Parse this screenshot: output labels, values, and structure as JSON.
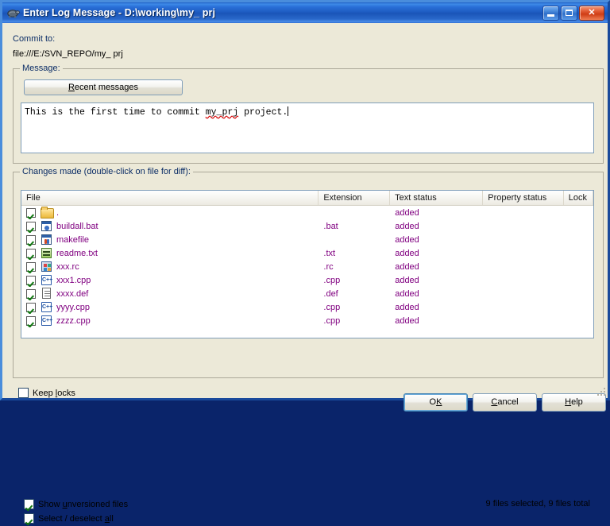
{
  "window": {
    "title": "Enter Log Message - D:\\working\\my_ prj",
    "icon": "tortoise-icon",
    "minimize_label": "",
    "maximize_label": "",
    "close_label": "✕"
  },
  "commit": {
    "label": "Commit to:",
    "url": "file:///E:/SVN_REPO/my_ prj"
  },
  "message_group": {
    "title": "Message:",
    "recent_button": {
      "accel": "R",
      "rest": "ecent messages"
    },
    "text_before": "This is the first time to commit ",
    "text_misspelled": "my_prj",
    "text_after": " project."
  },
  "changes_group": {
    "title": "Changes made (double-click on file for diff):",
    "columns": [
      "File",
      "Extension",
      "Text status",
      "Property status",
      "Lock"
    ],
    "rows": [
      {
        "checked": true,
        "icon": "folder-icon",
        "name": ".",
        "extension": "",
        "text_status": "added",
        "property_status": "",
        "lock": ""
      },
      {
        "checked": true,
        "icon": "batch-file-icon",
        "name": "buildall.bat",
        "extension": ".bat",
        "text_status": "added",
        "property_status": "",
        "lock": ""
      },
      {
        "checked": true,
        "icon": "makefile-icon",
        "name": "makefile",
        "extension": "",
        "text_status": "added",
        "property_status": "",
        "lock": ""
      },
      {
        "checked": true,
        "icon": "text-image-icon",
        "name": "readme.txt",
        "extension": ".txt",
        "text_status": "added",
        "property_status": "",
        "lock": ""
      },
      {
        "checked": true,
        "icon": "resource-file-icon",
        "name": "xxx.rc",
        "extension": ".rc",
        "text_status": "added",
        "property_status": "",
        "lock": ""
      },
      {
        "checked": true,
        "icon": "cpp-file-icon",
        "name": "xxx1.cpp",
        "extension": ".cpp",
        "text_status": "added",
        "property_status": "",
        "lock": ""
      },
      {
        "checked": true,
        "icon": "document-icon",
        "name": "xxxx.def",
        "extension": ".def",
        "text_status": "added",
        "property_status": "",
        "lock": ""
      },
      {
        "checked": true,
        "icon": "cpp-file-icon",
        "name": "yyyy.cpp",
        "extension": ".cpp",
        "text_status": "added",
        "property_status": "",
        "lock": ""
      },
      {
        "checked": true,
        "icon": "cpp-file-icon",
        "name": "zzzz.cpp",
        "extension": ".cpp",
        "text_status": "added",
        "property_status": "",
        "lock": ""
      }
    ],
    "show_unversioned": {
      "checked": true,
      "pre": "Show ",
      "accel": "u",
      "post": "nversioned files"
    },
    "select_all": {
      "checked": true,
      "pre": "Select / deselect ",
      "accel": "a",
      "post": "ll"
    },
    "file_count": "9 files selected, 9 files total"
  },
  "footer": {
    "keep_locks": {
      "checked": false,
      "pre": "Keep ",
      "accel": "l",
      "post": "ocks"
    },
    "ok": {
      "pre": "O",
      "accel": "K",
      "post": ""
    },
    "cancel": {
      "pre": "",
      "accel": "C",
      "post": "ancel"
    },
    "help": {
      "pre": "",
      "accel": "H",
      "post": "elp"
    }
  },
  "colors": {
    "title_blue": "#1d5bc0",
    "dialog_face": "#ece9d8",
    "label_blue": "#0b2d66",
    "file_purple": "#800080",
    "check_green": "#117711"
  }
}
